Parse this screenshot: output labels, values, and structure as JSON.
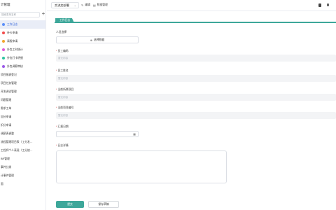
{
  "app": {
    "title": "计管理",
    "search_placeholder": "搜索表单名称",
    "add_symbol": "+"
  },
  "sidebar": {
    "items": [
      {
        "label": "工作日志",
        "sub": true,
        "dot": "#5b8ff9",
        "active": true
      },
      {
        "label": "补卡申请",
        "sub": true,
        "dot": "#f24c4c"
      },
      {
        "label": "请假申请",
        "sub": true,
        "dot": "#f2a52c"
      },
      {
        "label": "外包工时统计",
        "sub": true,
        "dot": "#e05ad9"
      },
      {
        "label": "外包打卡明细",
        "sub": true,
        "dot": "#2ec4a0"
      },
      {
        "label": "外包调薪审核",
        "sub": true,
        "dot": "#9b59e8"
      },
      {
        "label": "项目报表登记",
        "sub": false
      },
      {
        "label": "项目任务管理",
        "sub": false
      },
      {
        "label": "开发调试管理",
        "sub": false
      },
      {
        "label": "问题管理",
        "sub": false
      },
      {
        "label": "需求工单",
        "sub": false
      },
      {
        "label": "加分申请",
        "sub": false
      },
      {
        "label": "扣分申请",
        "sub": false
      },
      {
        "label": "调薪表调整",
        "sub": false
      },
      {
        "label": "流程管理项目表（工分发…",
        "sub": false
      },
      {
        "label": "工程师个人表现（工分统…",
        "sub": false
      },
      {
        "label": "BR管理",
        "sub": false
      },
      {
        "label": "事件分类",
        "sub": false
      },
      {
        "label": "计事件管理",
        "sub": false
      },
      {
        "label": "面",
        "sub": false
      }
    ]
  },
  "topbar": {
    "select_value": "交流加部署",
    "chevron": "⌄",
    "edit_label": "编辑",
    "data_label": "数据管理",
    "edit_icon": "✎",
    "data_icon": "▤"
  },
  "form": {
    "tab_label": "工作日志",
    "choose_person_label": "人员选择",
    "choose_button": "选择数据",
    "choose_icon": "⊕",
    "required_mark": "*",
    "employee_no_label": "员工编码",
    "employee_no_placeholder": "暂无内容",
    "employee_name_label": "员工姓名",
    "employee_name_placeholder": "暂无内容",
    "project_label": "当前所属项目",
    "project_placeholder": "暂无内容",
    "project_no_label": "当前项目编号",
    "project_no_placeholder": "暂无内容",
    "report_date_label": "汇报日期",
    "calendar_icon": "▦",
    "log_detail_label": "日志详情",
    "submit_label": "提交",
    "save_draft_label": "保存草稿"
  },
  "colors": {
    "accent": "#3da79a",
    "active_bg": "#e9edf7",
    "active_text": "#2b5fd8"
  }
}
